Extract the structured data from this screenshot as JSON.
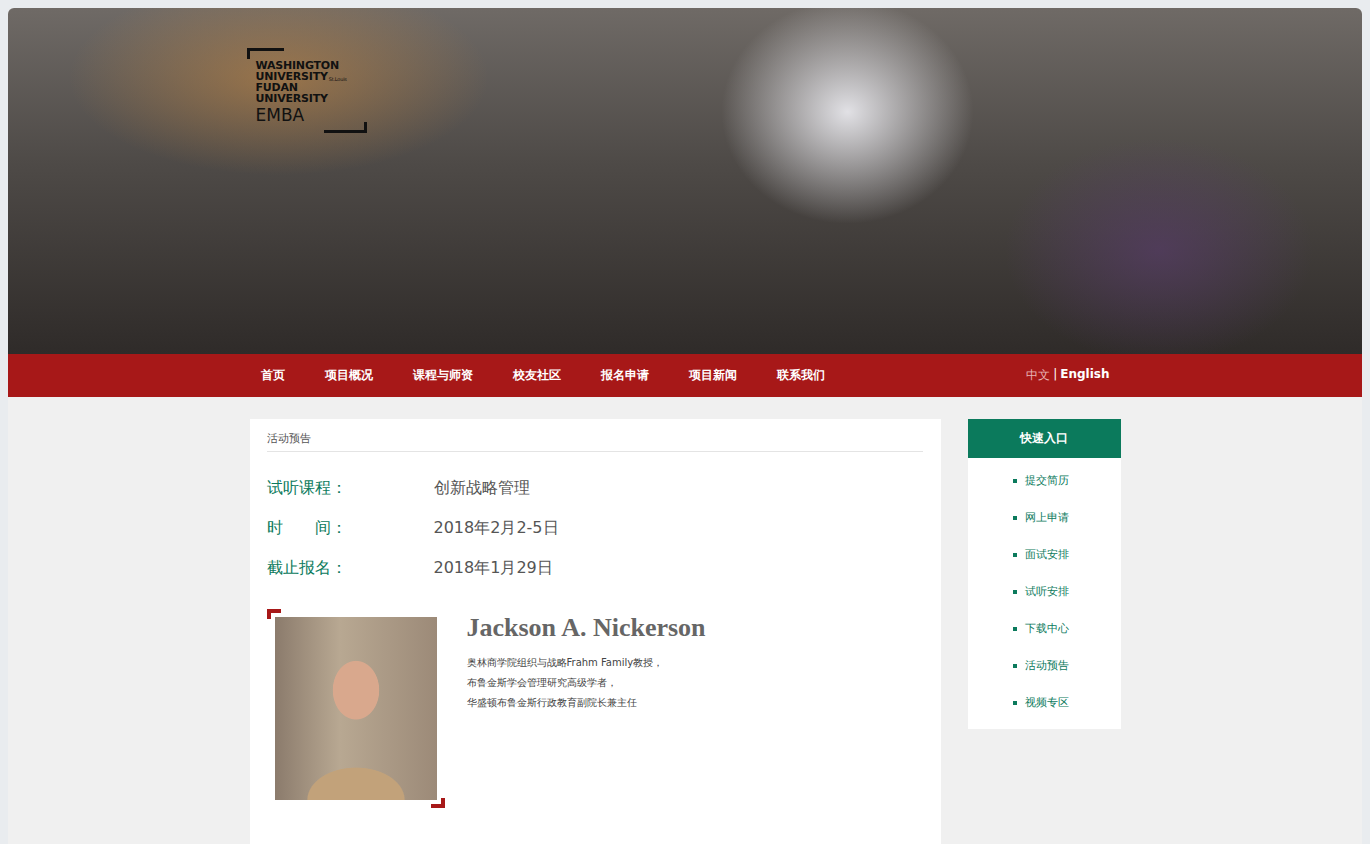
{
  "logo": {
    "lines": [
      {
        "text": "WASHINGTON",
        "suffix": ""
      },
      {
        "text": "UNIVERSITY",
        "suffix": "St.Louis"
      },
      {
        "text": "FUDAN",
        "suffix": ""
      },
      {
        "text": "UNIVERSITY",
        "suffix": ""
      }
    ],
    "program": "EMBA"
  },
  "nav": {
    "items": [
      {
        "label": "首页",
        "selected": false
      },
      {
        "label": "项目概况",
        "selected": false
      },
      {
        "label": "课程与师资",
        "selected": false
      },
      {
        "label": "校友社区",
        "selected": false
      },
      {
        "label": "报名申请",
        "selected": false
      },
      {
        "label": "项目新闻",
        "selected": false
      },
      {
        "label": "联系我们",
        "selected": false
      }
    ],
    "languages": [
      {
        "label": "中文",
        "selected": true
      },
      {
        "label": "English",
        "selected": false
      }
    ],
    "separator": "|"
  },
  "breadcrumb": "活动预告",
  "event": [
    {
      "label": "试听课程：",
      "value": "创新战略管理"
    },
    {
      "label": "时　　间：",
      "value": "2018年2月2-5日"
    },
    {
      "label": "截止报名：",
      "value": "2018年1月29日"
    }
  ],
  "speaker": {
    "name": "Jackson A. Nickerson",
    "titles": [
      "奥林商学院组织与战略Frahm Family教授，",
      "布鲁金斯学会管理研究高级学者，",
      "华盛顿布鲁金斯行政教育副院长兼主任"
    ]
  },
  "sidebar": {
    "title": "快速入口",
    "items": [
      "提交简历",
      "网上申请",
      "面试安排",
      "试听安排",
      "下载中心",
      "活动预告",
      "视频专区"
    ]
  }
}
